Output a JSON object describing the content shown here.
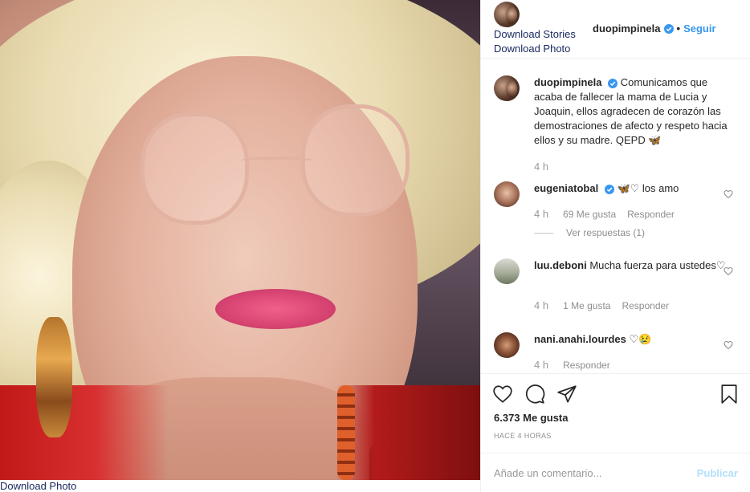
{
  "photo": {
    "download_label": "Download Photo"
  },
  "header": {
    "username": "duopimpinela",
    "separator": "•",
    "follow_label": "Seguir",
    "download_stories": "Download Stories",
    "download_photo": "Download Photo"
  },
  "caption": {
    "username": "duopimpinela",
    "text": "Comunicamos que acaba de fallecer la mama de Lucia y Joaquin, ellos agradecen de corazón las demostraciones de afecto y respeto hacia ellos y su madre. QEPD 🦋",
    "time": "4 h"
  },
  "comments": [
    {
      "username": "eugeniatobal",
      "text": "🦋♡ los amo",
      "time": "4 h",
      "likes": "69 Me gusta",
      "reply": "Responder",
      "view_replies": "Ver respuestas (1)"
    },
    {
      "username": "luu.deboni",
      "text": "Mucha fuerza para ustedes♡",
      "time": "4 h",
      "likes": "1 Me gusta",
      "reply": "Responder"
    },
    {
      "username": "nani.anahi.lourdes",
      "text": "♡😢",
      "time": "4 h",
      "reply": "Responder"
    }
  ],
  "actions": {
    "icons": [
      "heart-icon",
      "comment-icon",
      "share-icon",
      "bookmark-icon"
    ]
  },
  "post": {
    "likes": "6.373 Me gusta",
    "timestamp": "HACE 4 HORAS"
  },
  "compose": {
    "placeholder": "Añade un comentario...",
    "publish_label": "Publicar"
  },
  "colors": {
    "link_blue": "#3897f0",
    "download_text": "#1a2a60",
    "publish_disabled": "#b2dffc",
    "verified_blue": "#3897f0"
  }
}
